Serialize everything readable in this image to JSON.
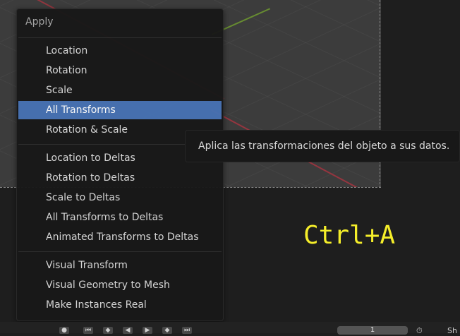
{
  "menu": {
    "title": "Apply",
    "items": [
      {
        "label": "Location",
        "active": false
      },
      {
        "label": "Rotation",
        "active": false
      },
      {
        "label": "Scale",
        "active": false
      },
      {
        "label": "All Transforms",
        "active": true
      },
      {
        "label": "Rotation & Scale",
        "active": false
      },
      {
        "label": "Location to Deltas",
        "active": false
      },
      {
        "label": "Rotation to Deltas",
        "active": false
      },
      {
        "label": "Scale to Deltas",
        "active": false
      },
      {
        "label": "All Transforms to Deltas",
        "active": false
      },
      {
        "label": "Animated Transforms to Deltas",
        "active": false
      },
      {
        "label": "Visual Transform",
        "active": false
      },
      {
        "label": "Visual Geometry to Mesh",
        "active": false
      },
      {
        "label": "Make Instances Real",
        "active": false
      }
    ]
  },
  "tooltip": {
    "text": "Aplica las transformaciones del objeto a sus datos."
  },
  "shortcut_overlay": "Ctrl+A",
  "timeline": {
    "current_frame": "1",
    "right_label": "Sh"
  },
  "colors": {
    "highlight": "#4772b3",
    "shortcut_text": "#f5ee2a",
    "menu_bg": "#181818"
  }
}
